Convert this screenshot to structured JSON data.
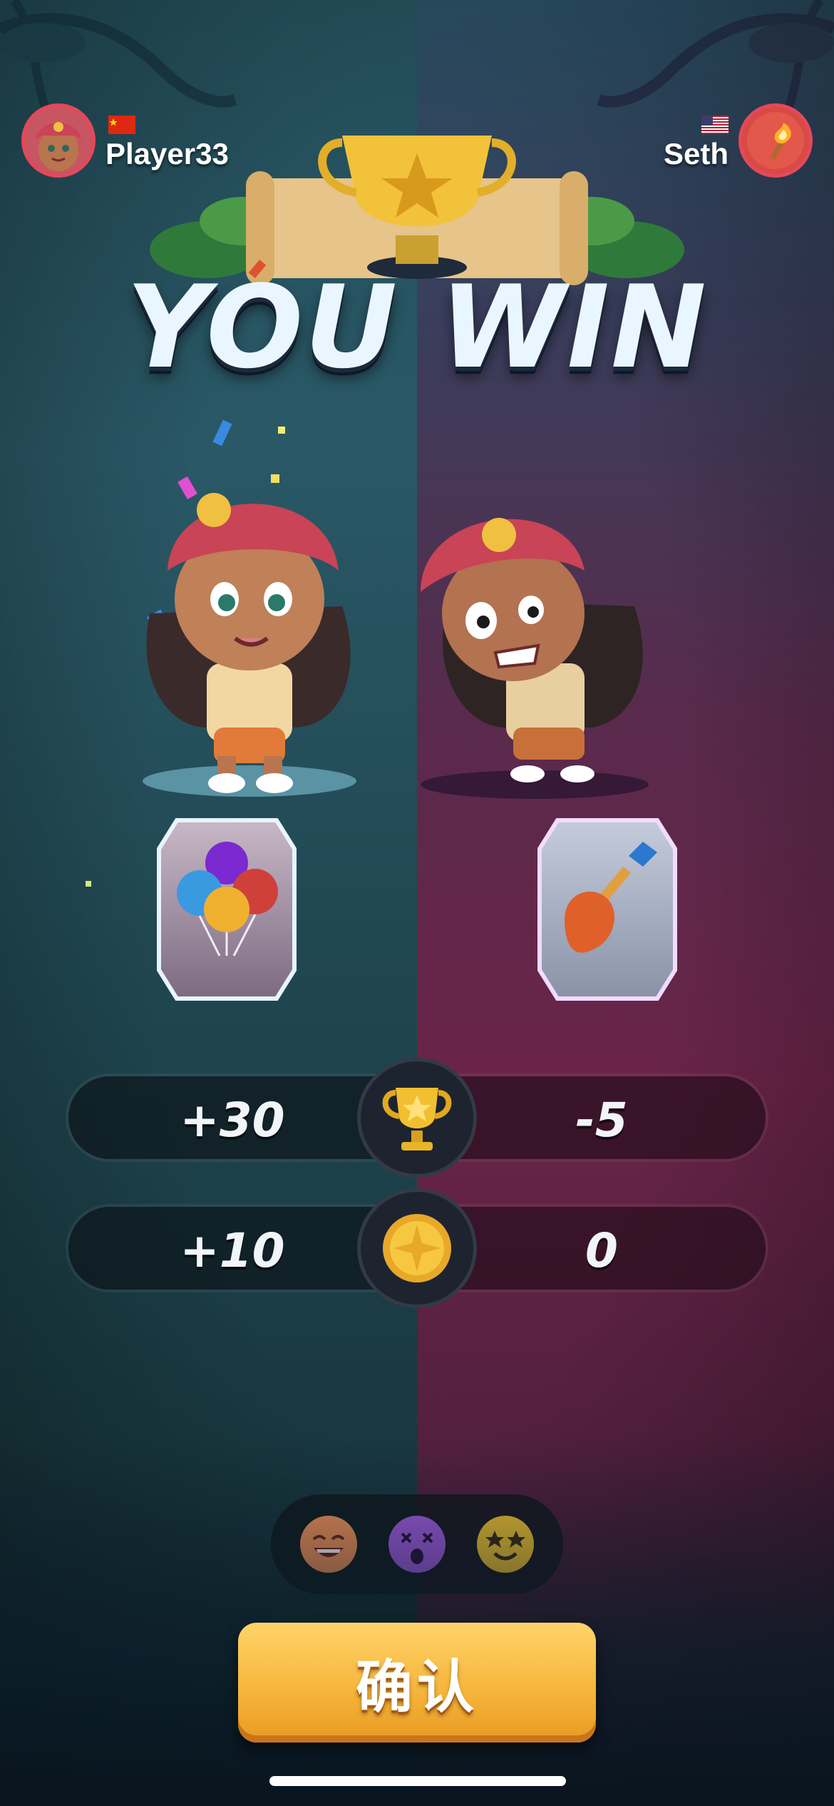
{
  "header": {
    "left_player": {
      "name": "Player33",
      "flag": "china-flag"
    },
    "right_player": {
      "name": "Seth",
      "flag": "usa-flag"
    }
  },
  "title": "YOU WIN",
  "cards": {
    "left": "balloons-card",
    "right": "shovel-card"
  },
  "stats": {
    "trophies": {
      "icon": "trophy-icon",
      "left": "+30",
      "right": "-5"
    },
    "coins": {
      "icon": "coin-icon",
      "left": "+10",
      "right": "0"
    }
  },
  "emojis": [
    "grin-emoji-icon",
    "dizzy-emoji-icon",
    "starstruck-emoji-icon"
  ],
  "confirm_label": "确认",
  "colors": {
    "left_team": "#24505c",
    "right_team": "#6a2448",
    "confirm_button": "#f7b63c",
    "avatar_border": "#e5485a"
  }
}
